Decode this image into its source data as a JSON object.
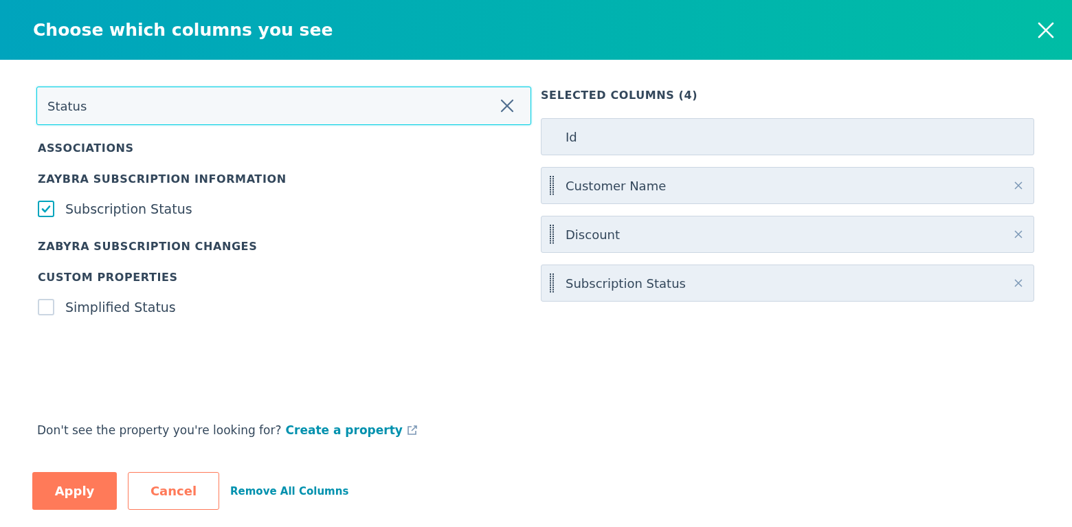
{
  "dialog": {
    "title": "Choose which columns you see"
  },
  "search": {
    "value": "Status"
  },
  "groups": [
    {
      "kind": "heading",
      "label": "ASSOCIATIONS"
    },
    {
      "kind": "heading",
      "label": "ZAYBRA SUBSCRIPTION INFORMATION"
    },
    {
      "kind": "checkbox",
      "label": "Subscription Status",
      "checked": true
    },
    {
      "kind": "heading",
      "label": "ZABYRA SUBSCRIPTION CHANGES"
    },
    {
      "kind": "heading",
      "label": "CUSTOM PROPERTIES"
    },
    {
      "kind": "checkbox",
      "label": "Simplified Status",
      "checked": false
    }
  ],
  "selected_columns": {
    "heading": "SELECTED COLUMNS (4)",
    "items": [
      {
        "label": "Id",
        "locked": true
      },
      {
        "label": "Customer Name",
        "locked": false
      },
      {
        "label": "Discount",
        "locked": false
      },
      {
        "label": "Subscription Status",
        "locked": false
      }
    ]
  },
  "help": {
    "text": "Don't see the property you're looking for?",
    "link": "Create a property"
  },
  "buttons": {
    "apply": "Apply",
    "cancel": "Cancel",
    "remove_all": "Remove All Columns"
  }
}
